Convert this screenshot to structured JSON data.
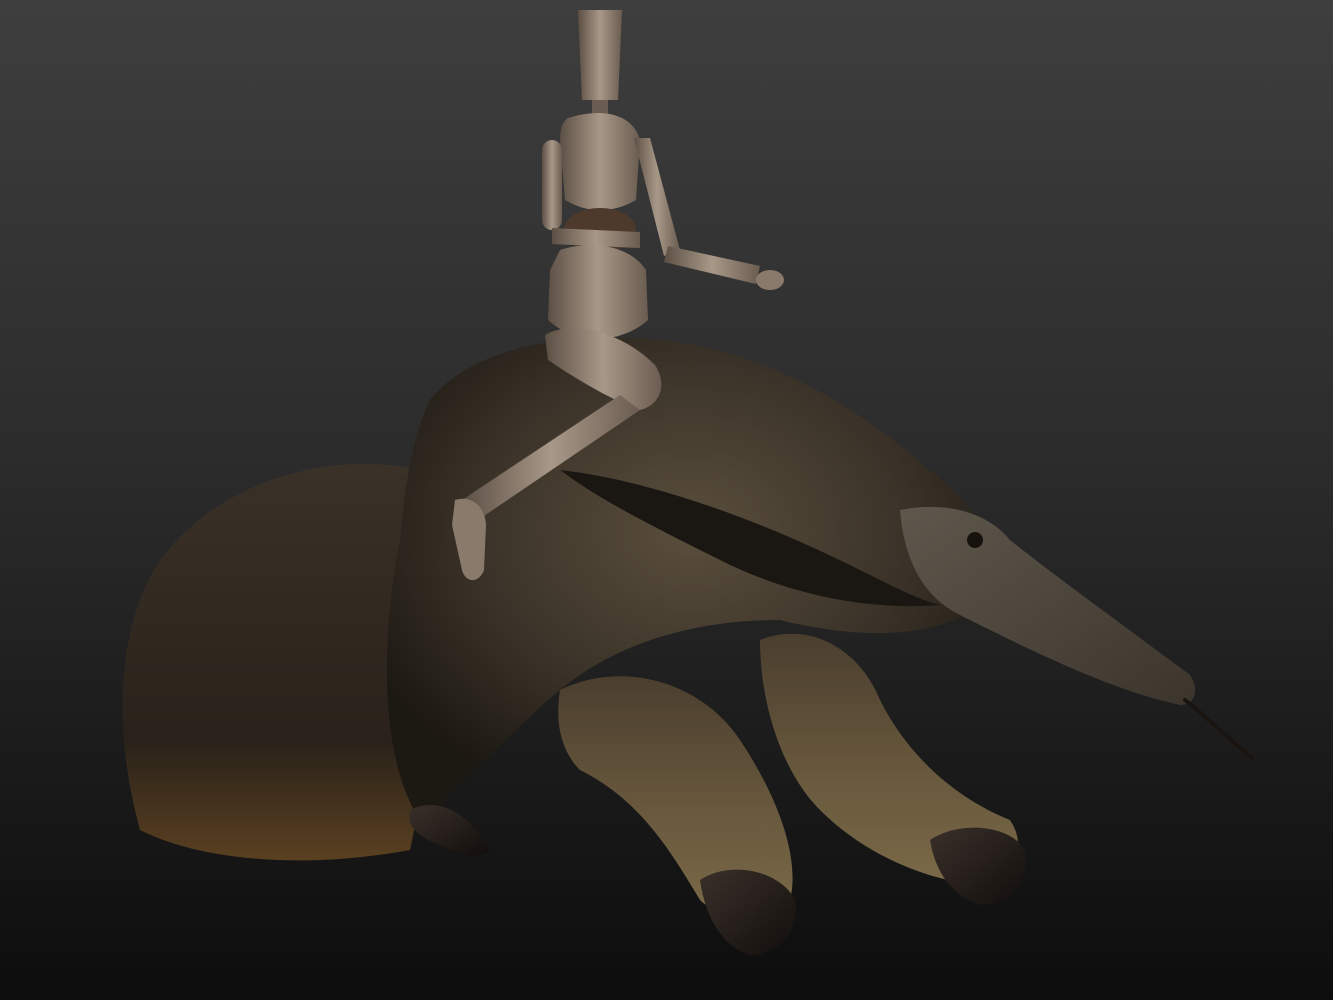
{
  "scene": {
    "subjects": [
      "wooden-mannequin",
      "giant-anteater"
    ],
    "colors": {
      "background_top": "#3e3e3e",
      "background_bottom": "#0d0d0d",
      "fur_dark": "#2a241c",
      "fur_mid": "#4a4032",
      "fur_light": "#6e5e44",
      "leg_fur": "#5a4a32",
      "claw": "#1a1512",
      "mannequin": "#8a7a6c",
      "mannequin_light": "#a99a8c",
      "mannequin_shadow": "#4e433a"
    }
  }
}
